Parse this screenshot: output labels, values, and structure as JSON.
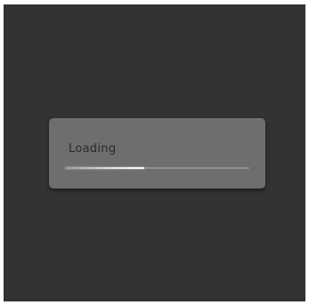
{
  "dialog": {
    "label": "Loading",
    "progress_fraction": 0.43
  },
  "colors": {
    "background": "#333333",
    "dialog": "#6e6e6e",
    "label_text": "#2b2b2b",
    "track": "#8e8e8e",
    "fill": "#ffffff"
  }
}
